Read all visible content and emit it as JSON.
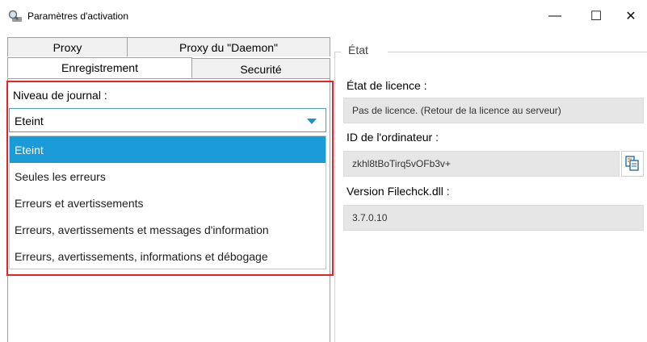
{
  "window": {
    "title": "Paramètres d'activation",
    "minimize_glyph": "—",
    "maximize_glyph": "☐",
    "close_glyph": "✕"
  },
  "tabs": {
    "back_row": [
      "Proxy",
      "Proxy du \"Daemon\""
    ],
    "front_row": [
      "Enregistrement",
      "Securité"
    ],
    "active": "Enregistrement"
  },
  "log": {
    "label": "Niveau de journal :",
    "selected": "Eteint",
    "options": [
      "Eteint",
      "Seules les erreurs",
      "Erreurs et avertissements",
      "Erreurs, avertissements et messages d'information",
      "Erreurs, avertissements, informations et débogage"
    ]
  },
  "state": {
    "group_title": "État",
    "license_label": "État de licence :",
    "license_value": "Pas de licence. (Retour de la licence au serveur)",
    "computer_id_label": "ID de l'ordinateur :",
    "computer_id_value": "zkhl8tBoTirq5vOFb3v+",
    "version_label": "Version Filechck.dll :",
    "version_value": "3.7.0.10"
  },
  "colors": {
    "accent": "#1a9ad6",
    "highlight_border": "#e8202c",
    "field_bg": "#e6e6e6"
  },
  "icons": [
    "app-magnifier-icon",
    "copy-icon",
    "chevron-down-icon"
  ]
}
